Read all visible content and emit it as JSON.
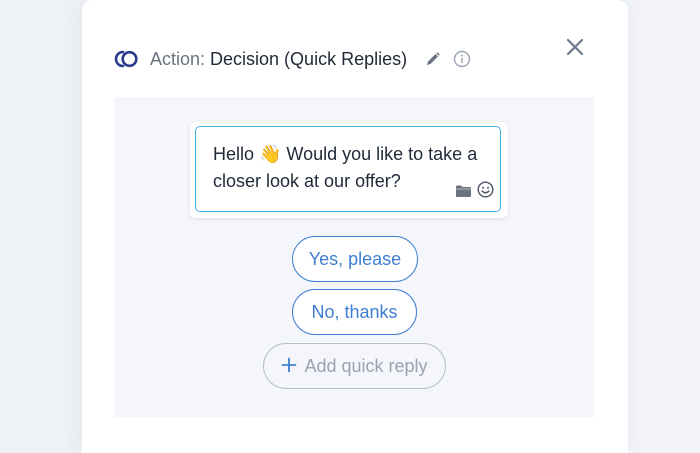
{
  "header": {
    "label_prefix": "Action:",
    "label_name": "Decision (Quick Replies)",
    "icons": [
      "action-logo-icon",
      "pencil-icon",
      "info-icon",
      "close-icon"
    ]
  },
  "message": {
    "line1": "Hello 👋 Would you like to take a",
    "line2": "closer look at our offer?",
    "tool_icons": [
      "folder-icon",
      "smiley-icon"
    ]
  },
  "quick_replies": [
    {
      "label": "Yes, please"
    },
    {
      "label": "No, thanks"
    }
  ],
  "add_reply": {
    "label": "Add quick reply",
    "icon": "plus-icon"
  },
  "colors": {
    "accent": "#3f7fd1",
    "bubble_border": "#4ab0e8",
    "logo": "#2c3a8c"
  }
}
